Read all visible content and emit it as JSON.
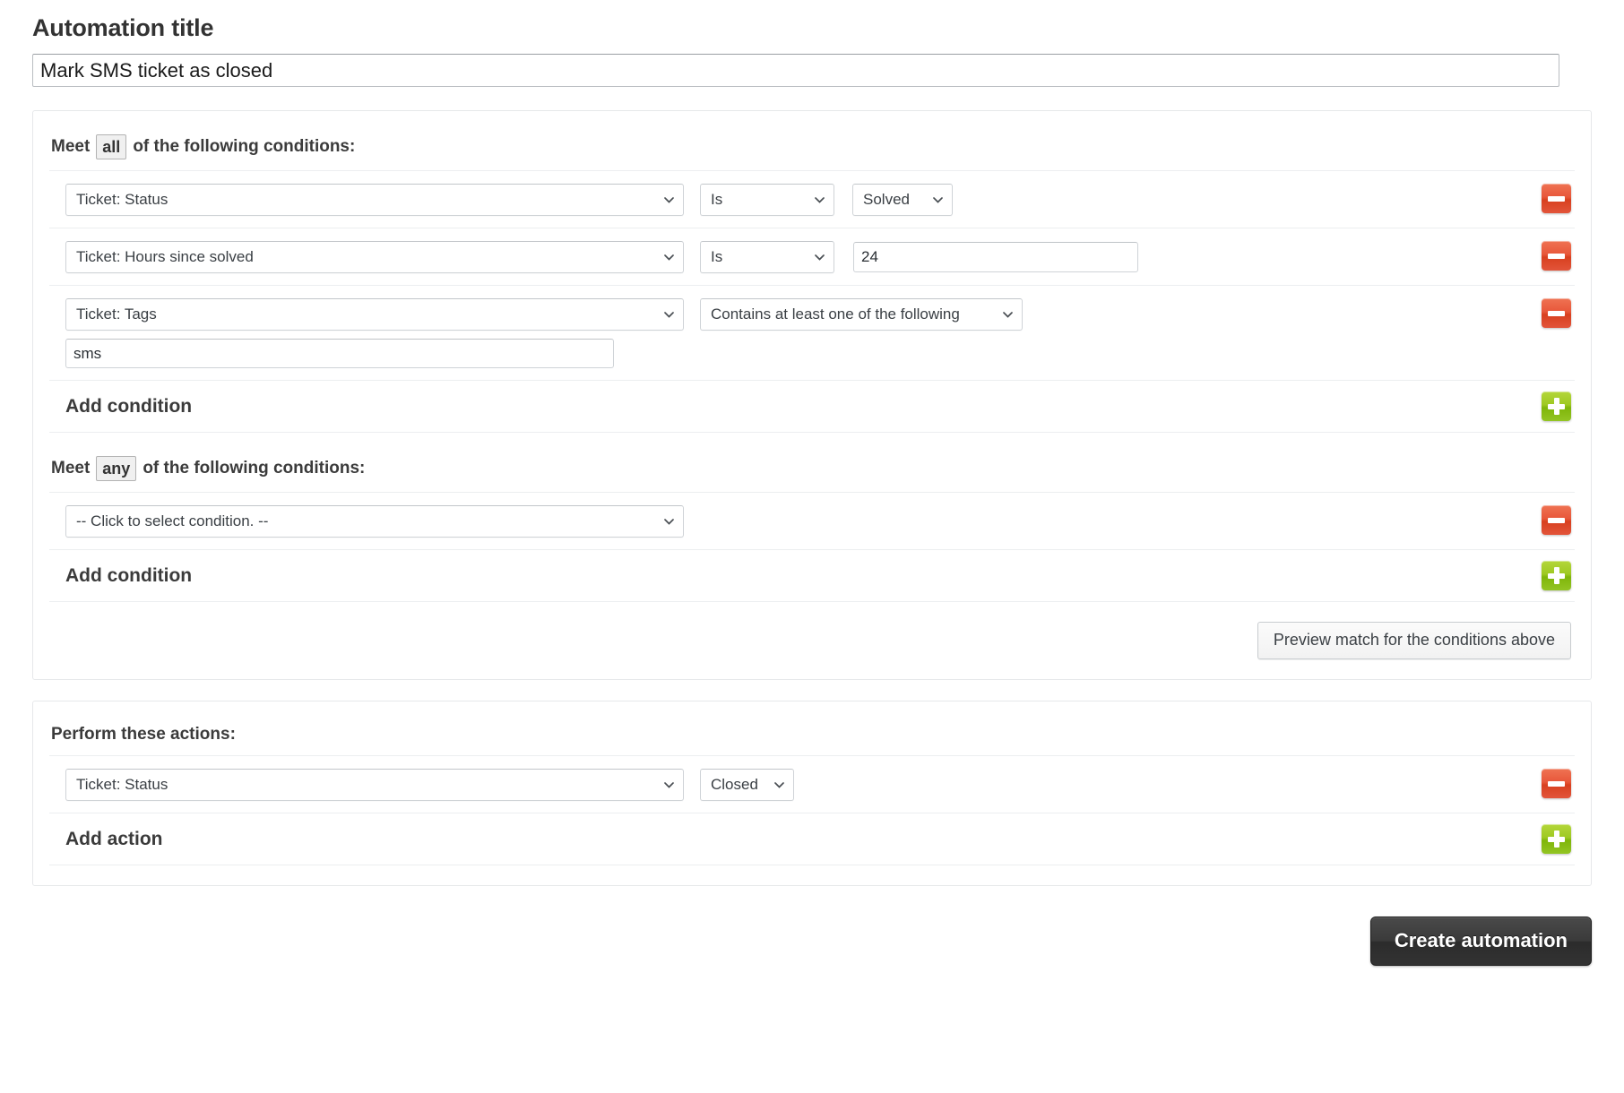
{
  "title": {
    "label": "Automation title",
    "value": "Mark SMS ticket as closed",
    "placeholder": "Automation title"
  },
  "conditions_all": {
    "prefix": "Meet",
    "match_type": "all",
    "suffix": "of the following conditions:",
    "rows": [
      {
        "field": "Ticket: Status",
        "operator": "Is",
        "value": "Solved",
        "value_kind": "select"
      },
      {
        "field": "Ticket: Hours since solved",
        "operator": "Is",
        "value": "24",
        "value_kind": "text"
      },
      {
        "field": "Ticket: Tags",
        "operator": "Contains at least one of the following",
        "value": "sms",
        "value_kind": "text-below"
      }
    ],
    "add_label": "Add condition"
  },
  "conditions_any": {
    "prefix": "Meet",
    "match_type": "any",
    "suffix": "of the following conditions:",
    "rows": [
      {
        "field": "-- Click to select condition. --",
        "operator": "",
        "value": "",
        "value_kind": "none"
      }
    ],
    "add_label": "Add condition"
  },
  "preview_button": "Preview match for the conditions above",
  "actions": {
    "label": "Perform these actions:",
    "rows": [
      {
        "field": "Ticket: Status",
        "value": "Closed",
        "value_kind": "select"
      }
    ],
    "add_label": "Add action"
  },
  "footer": {
    "submit_label": "Create automation"
  },
  "colors": {
    "remove_button": "#e8573a",
    "add_button": "#9ec922",
    "submit_button": "#333333",
    "text": "#3b3b3b",
    "border": "#cfd3d7"
  }
}
